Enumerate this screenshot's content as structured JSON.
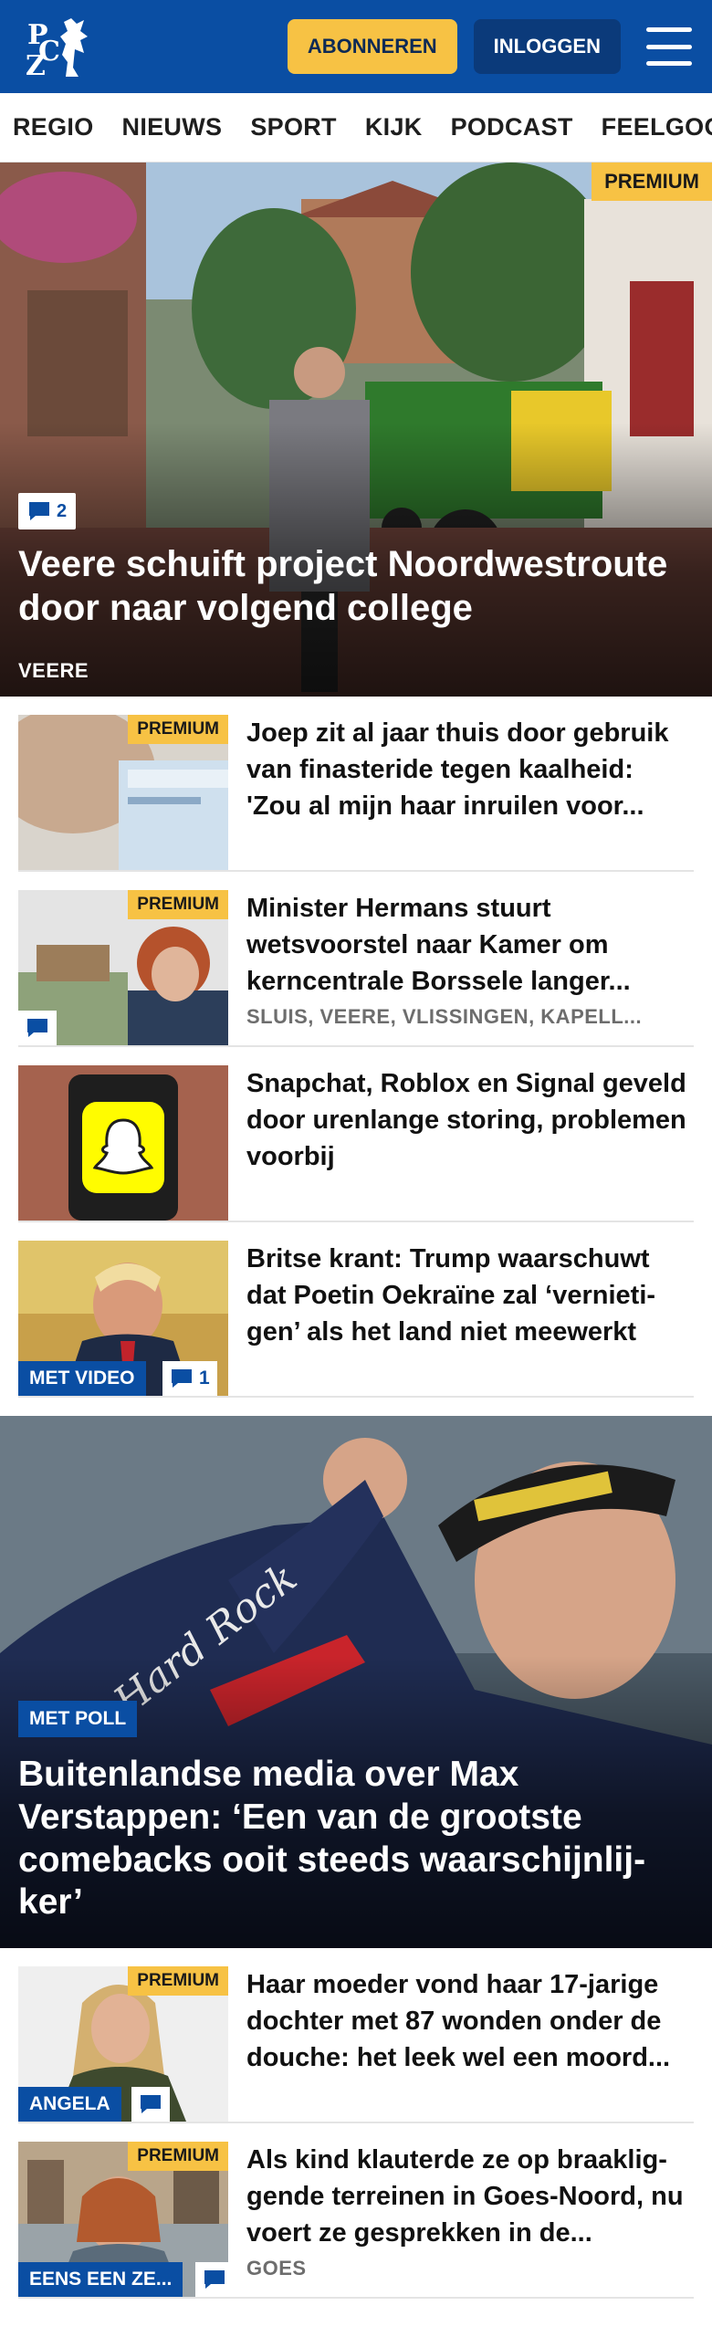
{
  "header": {
    "subscribe_label": "ABONNEREN",
    "login_label": "INLOGGEN",
    "colors": {
      "brand": "#0a4ea3",
      "accent": "#f7c244"
    }
  },
  "nav": {
    "items": [
      "REGIO",
      "NIEUWS",
      "SPORT",
      "KIJK",
      "PODCAST",
      "FEELGOOD"
    ]
  },
  "hero": {
    "badge": "PREMIUM",
    "comments": "2",
    "title": "Veere schuift project Noordwestroute door naar volgend college",
    "tag": "VEERE"
  },
  "articles": [
    {
      "title": "Joep zit al jaar thuis door gebruik van finasteride tegen kaalheid: 'Zou al mijn haar inruilen voor...",
      "premium": "PREMIUM"
    },
    {
      "title": "Minister Hermans stuurt wetsvoorstel naar Kamer om kerncentrale Borssele langer...",
      "premium": "PREMIUM",
      "sub": "SLUIS, VEERE, VLISSINGEN, KAPELL..."
    },
    {
      "title": "Snapchat, Roblox en Signal geveld door urenlange storing, problemen voorbij"
    },
    {
      "title": "Britse krant: Trump waarschuwt dat Poetin Oekraïne zal ‘vernieti-gen’ als het land niet meewerkt",
      "tag": "MET VIDEO",
      "comments": "1"
    }
  ],
  "feature": {
    "tag": "MET POLL",
    "title": "Buitenlandse media over Max Verstappen: ‘Een van de grootste comebacks ooit steeds waarschijnlij-ker’"
  },
  "articles2": [
    {
      "title": "Haar moeder vond haar 17-jarige dochter met 87 wonden onder de douche: het leek wel een moord...",
      "premium": "PREMIUM",
      "tag": "ANGELA"
    },
    {
      "title": "Als kind klauterde ze op braaklig-gende terreinen in Goes-Noord, nu voert ze gesprekken in de...",
      "premium": "PREMIUM",
      "tag": "EENS EEN ZE...",
      "sub": "GOES"
    }
  ]
}
